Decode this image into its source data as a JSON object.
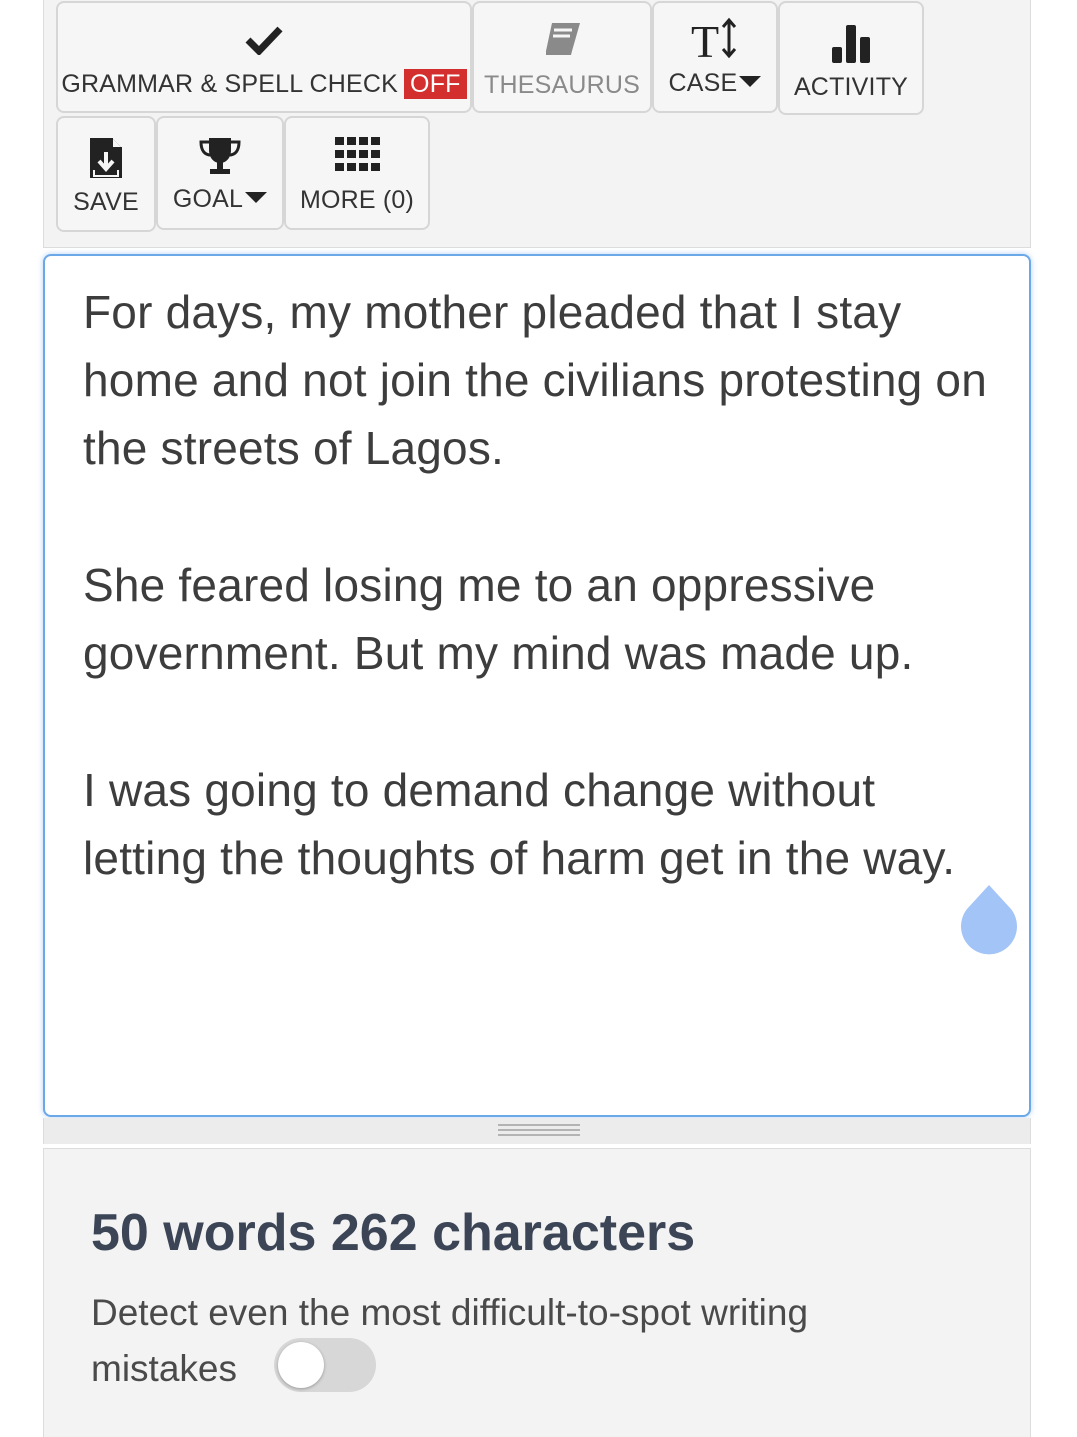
{
  "toolbar": {
    "grammar": {
      "label": "GRAMMAR & SPELL CHECK",
      "status": "OFF",
      "icon": "checkmark-icon"
    },
    "thesaurus": {
      "label": "THESAURUS",
      "icon": "book-icon"
    },
    "case": {
      "label": "CASE",
      "icon": "text-case-icon"
    },
    "activity": {
      "label": "ACTIVITY",
      "icon": "bar-chart-icon"
    },
    "save": {
      "label": "SAVE",
      "icon": "save-file-icon"
    },
    "goal": {
      "label": "GOAL",
      "icon": "trophy-icon"
    },
    "more": {
      "label": "MORE (0)",
      "icon": "grid-icon"
    }
  },
  "editor": {
    "paragraphs": [
      "For days, my mother pleaded that I stay home and not join the civilians protesting on the streets of Lagos.",
      "She feared losing me to an oppressive government. But my mind was made up.",
      "I was going to demand change without letting the thoughts of harm get in the way."
    ]
  },
  "stats": {
    "counts": "50 words 262 characters",
    "detect_label": "Detect even the most difficult-to-spot writing mistakes",
    "toggle_on": false
  },
  "colors": {
    "off_badge": "#d32f2f",
    "editor_border": "#6aa8e8",
    "counts_text": "#3b4556",
    "cursor_handle": "#a3c4f7"
  }
}
